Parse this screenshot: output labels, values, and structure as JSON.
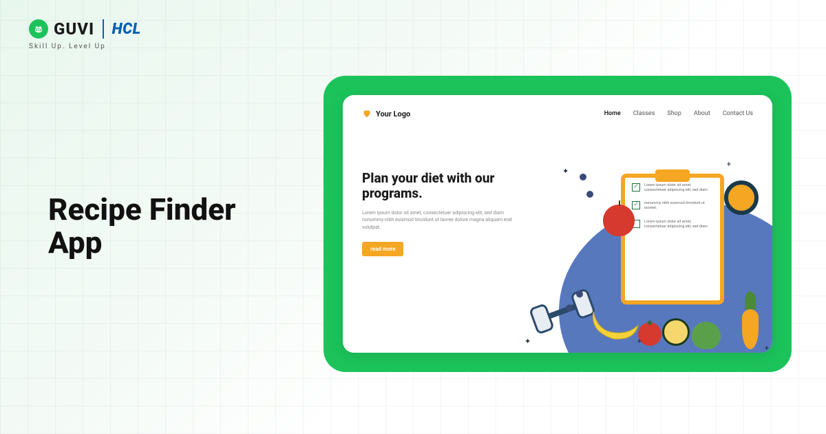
{
  "header": {
    "guvi_icon_glyph": "ෂ",
    "guvi_text": "GUVI",
    "hcl_text": "HCL",
    "tagline": "Skill Up. Level Up"
  },
  "main": {
    "title_line1": "Recipe Finder",
    "title_line2": "App"
  },
  "mockup": {
    "logo_text": "Your Logo",
    "nav": [
      {
        "label": "Home",
        "active": true
      },
      {
        "label": "Classes",
        "active": false
      },
      {
        "label": "Shop",
        "active": false
      },
      {
        "label": "About",
        "active": false
      },
      {
        "label": "Contact Us",
        "active": false
      }
    ],
    "hero": {
      "heading": "Plan your diet with our programs.",
      "body": "Lorem ipsum dolor sit amet, consectetuer adipiscing elit, sed diam nonummy nibh euismod tincidunt ut laoree dolore magna aliquam erat volutpat.",
      "button": "read more"
    },
    "checklist": [
      {
        "text": "Lorem ipsum dolor sit amet, consectetuer adipiscing elit, sed diam",
        "checked": true
      },
      {
        "text": "nonummy nibh euismod tincidunt ut laoreet.",
        "checked": true
      },
      {
        "text": "Lorem ipsum dolor sit amet, consectetuer adipiscing elit, sed diam",
        "checked": false
      }
    ]
  }
}
